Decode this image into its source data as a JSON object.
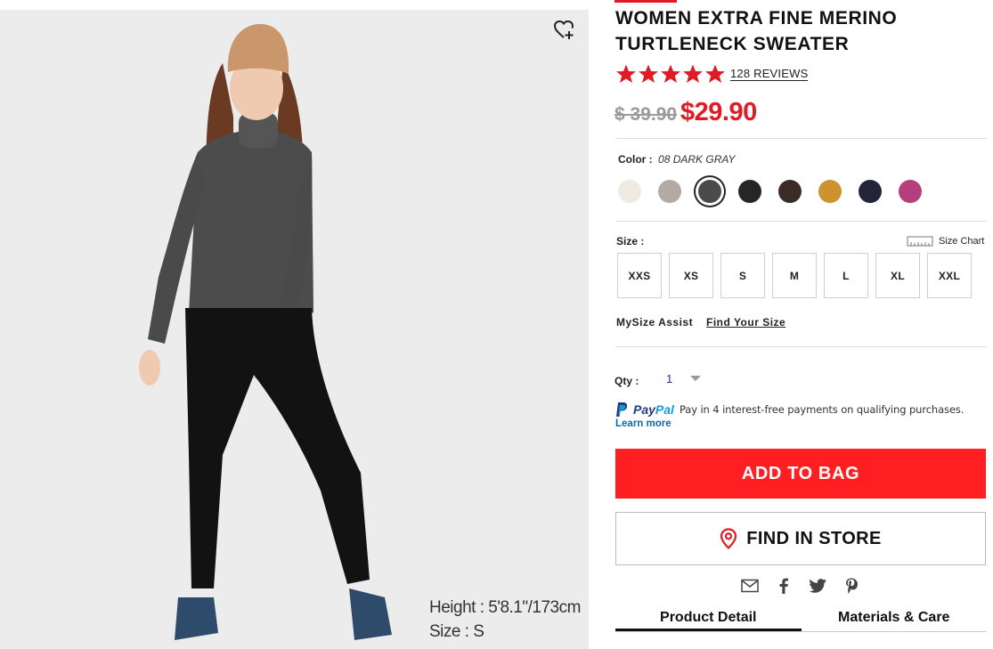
{
  "product": {
    "title": "WOMEN EXTRA FINE MERINO TURTLENECK SWEATER",
    "rating": 5,
    "reviews_label": "128 REVIEWS",
    "price_old": "$ 39.90",
    "price_new": "$29.90"
  },
  "photo": {
    "model_height": "Height : 5'8.1\"/173cm",
    "model_size": "Size : S",
    "wishlist_icon": "heart-plus-icon"
  },
  "color": {
    "label": "Color :",
    "value": "08 DARK GRAY",
    "swatches": [
      "#efebe3",
      "#b2aaa5",
      "#4b4b4b",
      "#262626",
      "#3a2d27",
      "#cc932f",
      "#232438",
      "#b73e7c"
    ],
    "selected_index": 2
  },
  "size": {
    "label": "Size :",
    "chart_label": "Size Chart",
    "options": [
      "XXS",
      "XS",
      "S",
      "M",
      "L",
      "XL",
      "XXL"
    ]
  },
  "mysize": {
    "label": "MySize Assist",
    "link": "Find Your Size"
  },
  "qty": {
    "label": "Qty :",
    "value": "1"
  },
  "paypal": {
    "brand_pay": "Pay",
    "brand_pal": "Pal",
    "text": "Pay in 4 interest-free payments on qualifying purchases.",
    "learn_more": "Learn more"
  },
  "actions": {
    "add_to_bag": "ADD TO BAG",
    "find_in_store": "FIND IN STORE"
  },
  "share_icons": [
    "mail-icon",
    "facebook-icon",
    "twitter-icon",
    "pinterest-icon"
  ],
  "tabs": [
    {
      "label": "Product Detail",
      "active": true
    },
    {
      "label": "Materials & Care",
      "active": false
    }
  ],
  "colors": {
    "accent": "#ff1e22",
    "price_red": "#e01b24",
    "link_blue": "#0a6ab8"
  }
}
